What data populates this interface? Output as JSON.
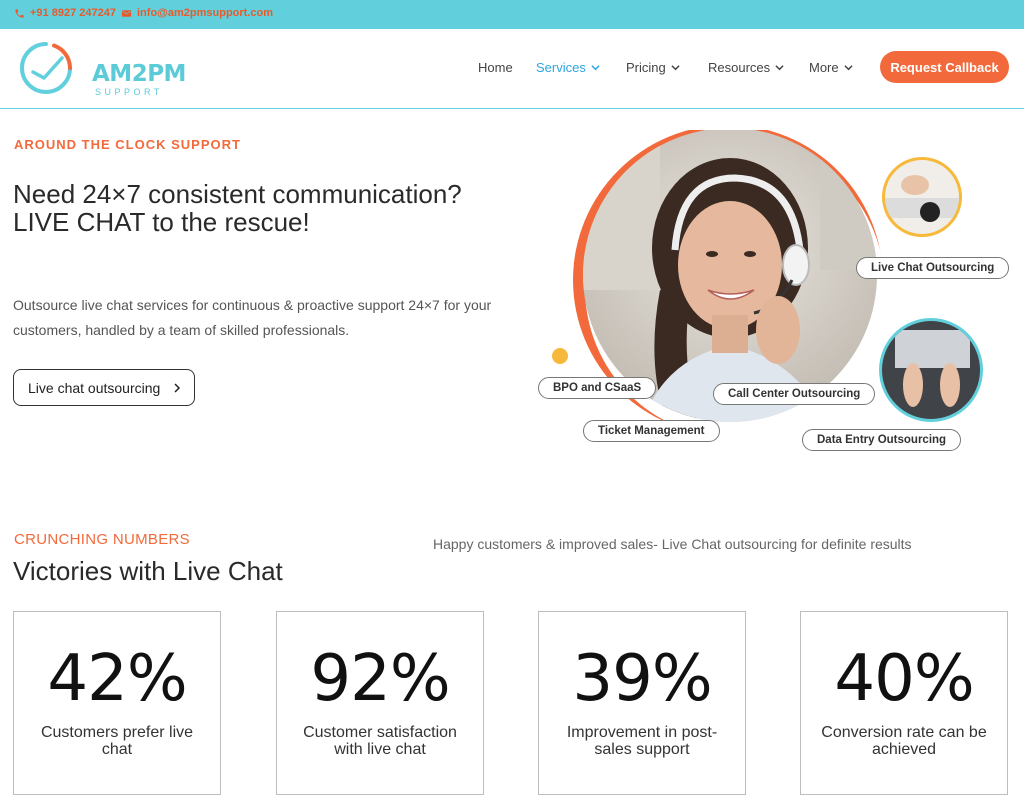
{
  "topbar": {
    "phone": "+91 8927 247247",
    "email": "info@am2pmsupport.com"
  },
  "brand": {
    "name": "AM2PM",
    "tagline": "SUPPORT"
  },
  "nav": {
    "items": [
      {
        "label": "Home"
      },
      {
        "label": "Services"
      },
      {
        "label": "Pricing"
      },
      {
        "label": "Resources"
      },
      {
        "label": "More"
      }
    ],
    "cta": "Request Callback"
  },
  "hero": {
    "eyebrow": "AROUND THE CLOCK SUPPORT",
    "title": "Need 24×7 consistent communication? LIVE CHAT to the rescue!",
    "description": "Outsource live chat services for continuous & proactive support 24×7 for your customers, handled by a team of skilled professionals.",
    "button": "Live chat outsourcing",
    "pills": [
      "Live Chat Outsourcing",
      "BPO and CSaaS",
      "Call Center Outsourcing",
      "Ticket Management",
      "Data Entry Outsourcing"
    ]
  },
  "numbers": {
    "eyebrow": "CRUNCHING NUMBERS",
    "title": "Victories with Live Chat",
    "subtitle": "Happy customers & improved sales- Live Chat outsourcing for definite results",
    "stats": [
      {
        "value": "42%",
        "label": "Customers prefer live chat"
      },
      {
        "value": "92%",
        "label": "Customer satisfaction with live chat"
      },
      {
        "value": "39%",
        "label": "Improvement in post-sales support"
      },
      {
        "value": "40%",
        "label": "Conversion rate can be achieved"
      }
    ]
  },
  "colors": {
    "accent": "#f26a3b",
    "brand": "#62d0dc",
    "link_active": "#2ea6e0"
  }
}
